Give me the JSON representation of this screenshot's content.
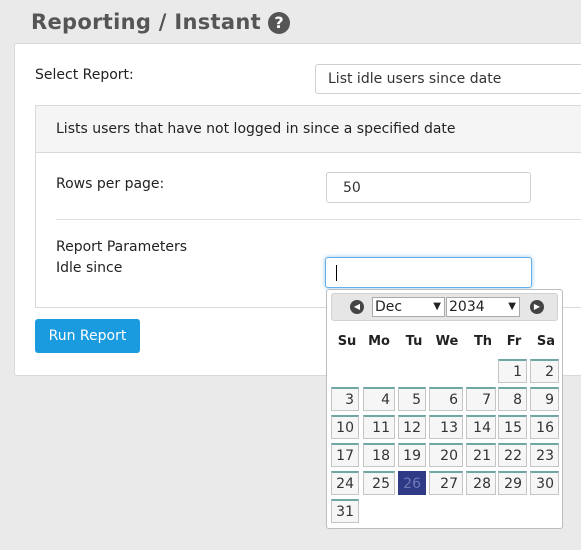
{
  "header": {
    "title": "Reporting / Instant",
    "help_icon": "?"
  },
  "form": {
    "select_report_label": "Select Report:",
    "select_report_value": "List idle users since date",
    "description": "Lists users that have not logged in since a specified date",
    "rows_per_page_label": "Rows per page:",
    "rows_per_page_value": "50",
    "report_params_label": "Report Parameters",
    "idle_since_label": "Idle since",
    "idle_since_value": "",
    "run_button": "Run Report"
  },
  "datepicker": {
    "prev": "◀",
    "next": "▶",
    "month": "Dec",
    "year": "2034",
    "weekdays": [
      "Su",
      "Mo",
      "Tu",
      "We",
      "Th",
      "Fr",
      "Sa"
    ],
    "days": [
      "1",
      "2",
      "3",
      "4",
      "5",
      "6",
      "7",
      "8",
      "9",
      "10",
      "11",
      "12",
      "13",
      "14",
      "15",
      "16",
      "17",
      "18",
      "19",
      "20",
      "21",
      "22",
      "23",
      "24",
      "25",
      "26",
      "27",
      "28",
      "29",
      "30",
      "31"
    ],
    "selected_day": "26",
    "accent": "#2e3a86"
  },
  "colors": {
    "button": "#1a9be0",
    "focus": "#66afe9"
  }
}
